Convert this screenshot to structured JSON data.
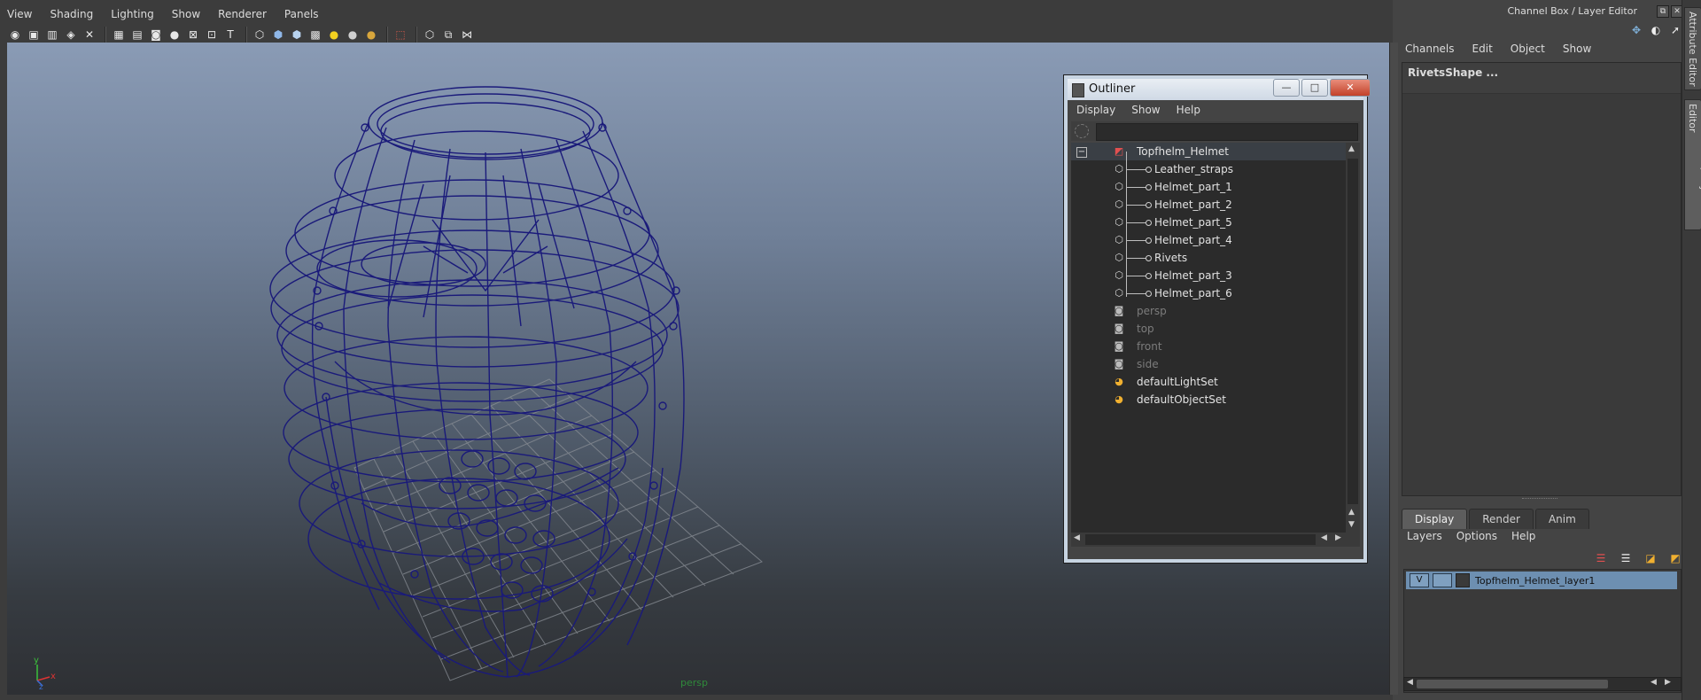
{
  "viewport_panel": {
    "menus": [
      "View",
      "Shading",
      "Lighting",
      "Show",
      "Renderer",
      "Panels"
    ],
    "toolbar_icons": [
      "select-camera-icon",
      "camera-attributes-icon",
      "bookmarks-icon",
      "image-plane-icon",
      "2d-pan-zoom-icon",
      "grease-pencil-icon",
      "grid-icon",
      "film-gate-icon",
      "resolution-gate-icon",
      "gate-mask-icon",
      "field-chart-icon",
      "safe-action-icon",
      "safe-title-icon",
      "wireframe-icon",
      "smooth-shade-icon",
      "wireframe-on-shaded-icon",
      "textured-icon",
      "use-all-lights-icon",
      "shadows-icon",
      "screen-space-ao-icon",
      "isolate-select-icon",
      "xray-icon",
      "xray-joints-icon",
      "xray-components-icon"
    ],
    "camera_label": "persp",
    "axis": {
      "y": "y",
      "x": "x",
      "z": "z"
    }
  },
  "channel_box": {
    "title": "Channel Box / Layer Editor",
    "menus": [
      "Channels",
      "Edit",
      "Object",
      "Show"
    ],
    "selected_shape": "RivetsShape ..."
  },
  "layer_editor": {
    "tabs": [
      "Display",
      "Render",
      "Anim"
    ],
    "active_tab": "Display",
    "menus": [
      "Layers",
      "Options",
      "Help"
    ],
    "layer": {
      "visibility": "V",
      "name": "Topfhelm_Helmet_layer1"
    }
  },
  "side_tabs": [
    "Attribute Editor",
    "Channel Box / Layer Editor"
  ],
  "outliner": {
    "title": "Outliner",
    "menus": [
      "Display",
      "Show",
      "Help"
    ],
    "window_buttons": {
      "minimize": "—",
      "maximize": "□",
      "close": "✕"
    },
    "root": {
      "expander": "−",
      "name": "Topfhelm_Helmet"
    },
    "children": [
      "Leather_straps",
      "Helmet_part_1",
      "Helmet_part_2",
      "Helmet_part_5",
      "Helmet_part_4",
      "Rivets",
      "Helmet_part_3",
      "Helmet_part_6"
    ],
    "cameras": [
      "persp",
      "top",
      "front",
      "side"
    ],
    "sets": [
      "defaultLightSet",
      "defaultObjectSet"
    ]
  },
  "colors": {
    "wireframe": "#1a1a7a",
    "layer_selected": "#6d8fb1",
    "camera_label": "#2f8a3a"
  }
}
